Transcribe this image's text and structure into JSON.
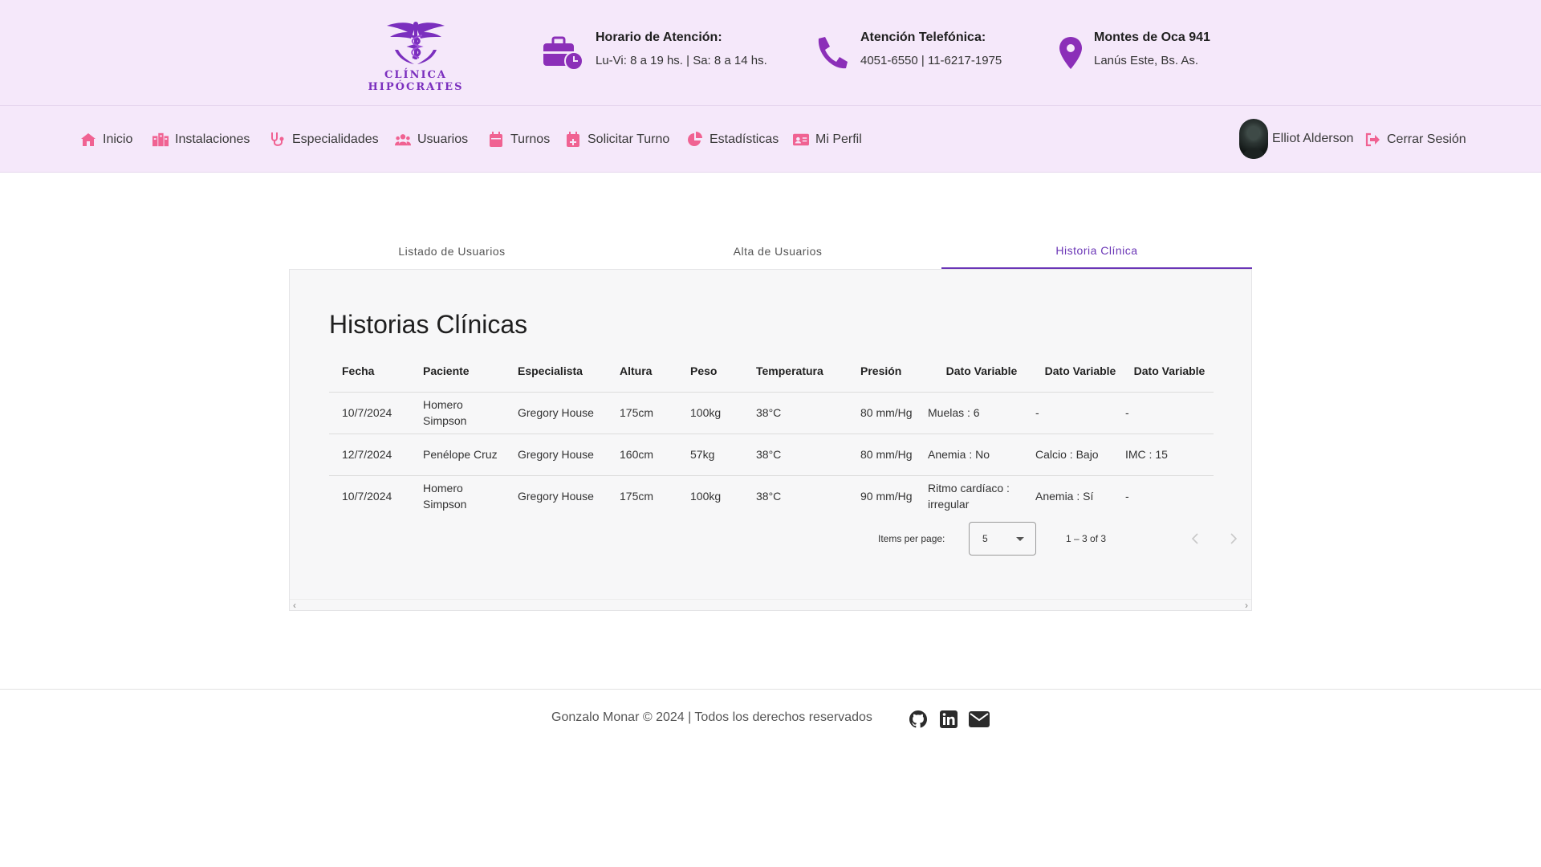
{
  "brand": {
    "name": "CLÍNICA HIPÓCRATES",
    "color": "#7b2fbe"
  },
  "header": {
    "hours": {
      "title": "Horario de Atención:",
      "value": "Lu-Vi: 8 a 19 hs. | Sa: 8 a 14 hs.",
      "icon": "briefcase-clock-icon"
    },
    "phone": {
      "title": "Atención Telefónica:",
      "value": "4051-6550 | 11-6217-1975",
      "icon": "phone-icon"
    },
    "address": {
      "title": "Montes de Oca 941",
      "value": "Lanús Este, Bs. As.",
      "icon": "map-pin-icon"
    }
  },
  "nav": {
    "items": [
      {
        "label": "Inicio",
        "icon": "home-icon"
      },
      {
        "label": "Instalaciones",
        "icon": "hospital-icon"
      },
      {
        "label": "Especialidades",
        "icon": "stethoscope-icon"
      },
      {
        "label": "Usuarios",
        "icon": "users-icon"
      },
      {
        "label": "Turnos",
        "icon": "calendar-icon"
      },
      {
        "label": "Solicitar Turno",
        "icon": "calendar-plus-icon"
      },
      {
        "label": "Estadísticas",
        "icon": "pie-chart-icon"
      },
      {
        "label": "Mi Perfil",
        "icon": "id-card-icon"
      }
    ],
    "user_name": "Elliot Alderson",
    "logout_label": "Cerrar Sesión",
    "accent_color": "#f06292"
  },
  "tabs": [
    {
      "label": "Listado de Usuarios",
      "active": false
    },
    {
      "label": "Alta de Usuarios",
      "active": false
    },
    {
      "label": "Historia Clínica",
      "active": true
    }
  ],
  "section": {
    "title": "Historias Clínicas",
    "columns": [
      "Fecha",
      "Paciente",
      "Especialista",
      "Altura",
      "Peso",
      "Temperatura",
      "Presión",
      "Dato Variable",
      "Dato Variable",
      "Dato Variable"
    ],
    "rows": [
      [
        "10/7/2024",
        "Homero Simpson",
        "Gregory House",
        "175cm",
        "100kg",
        "38°C",
        "80 mm/Hg",
        "Muelas : 6",
        "-",
        "-"
      ],
      [
        "12/7/2024",
        "Penélope Cruz",
        "Gregory House",
        "160cm",
        "57kg",
        "38°C",
        "80 mm/Hg",
        "Anemia : No",
        "Calcio : Bajo",
        "IMC : 15"
      ],
      [
        "10/7/2024",
        "Homero Simpson",
        "Gregory House",
        "175cm",
        "100kg",
        "38°C",
        "90 mm/Hg",
        "Ritmo cardíaco : irregular",
        "Anemia : Sí",
        "-"
      ]
    ],
    "paginator": {
      "items_per_page_label": "Items per page:",
      "page_size": "5",
      "range": "1 – 3 of 3"
    }
  },
  "footer": {
    "text": "Gonzalo Monar © 2024 | Todos los derechos reservados",
    "icons": [
      "github-icon",
      "linkedin-icon",
      "envelope-icon"
    ]
  }
}
